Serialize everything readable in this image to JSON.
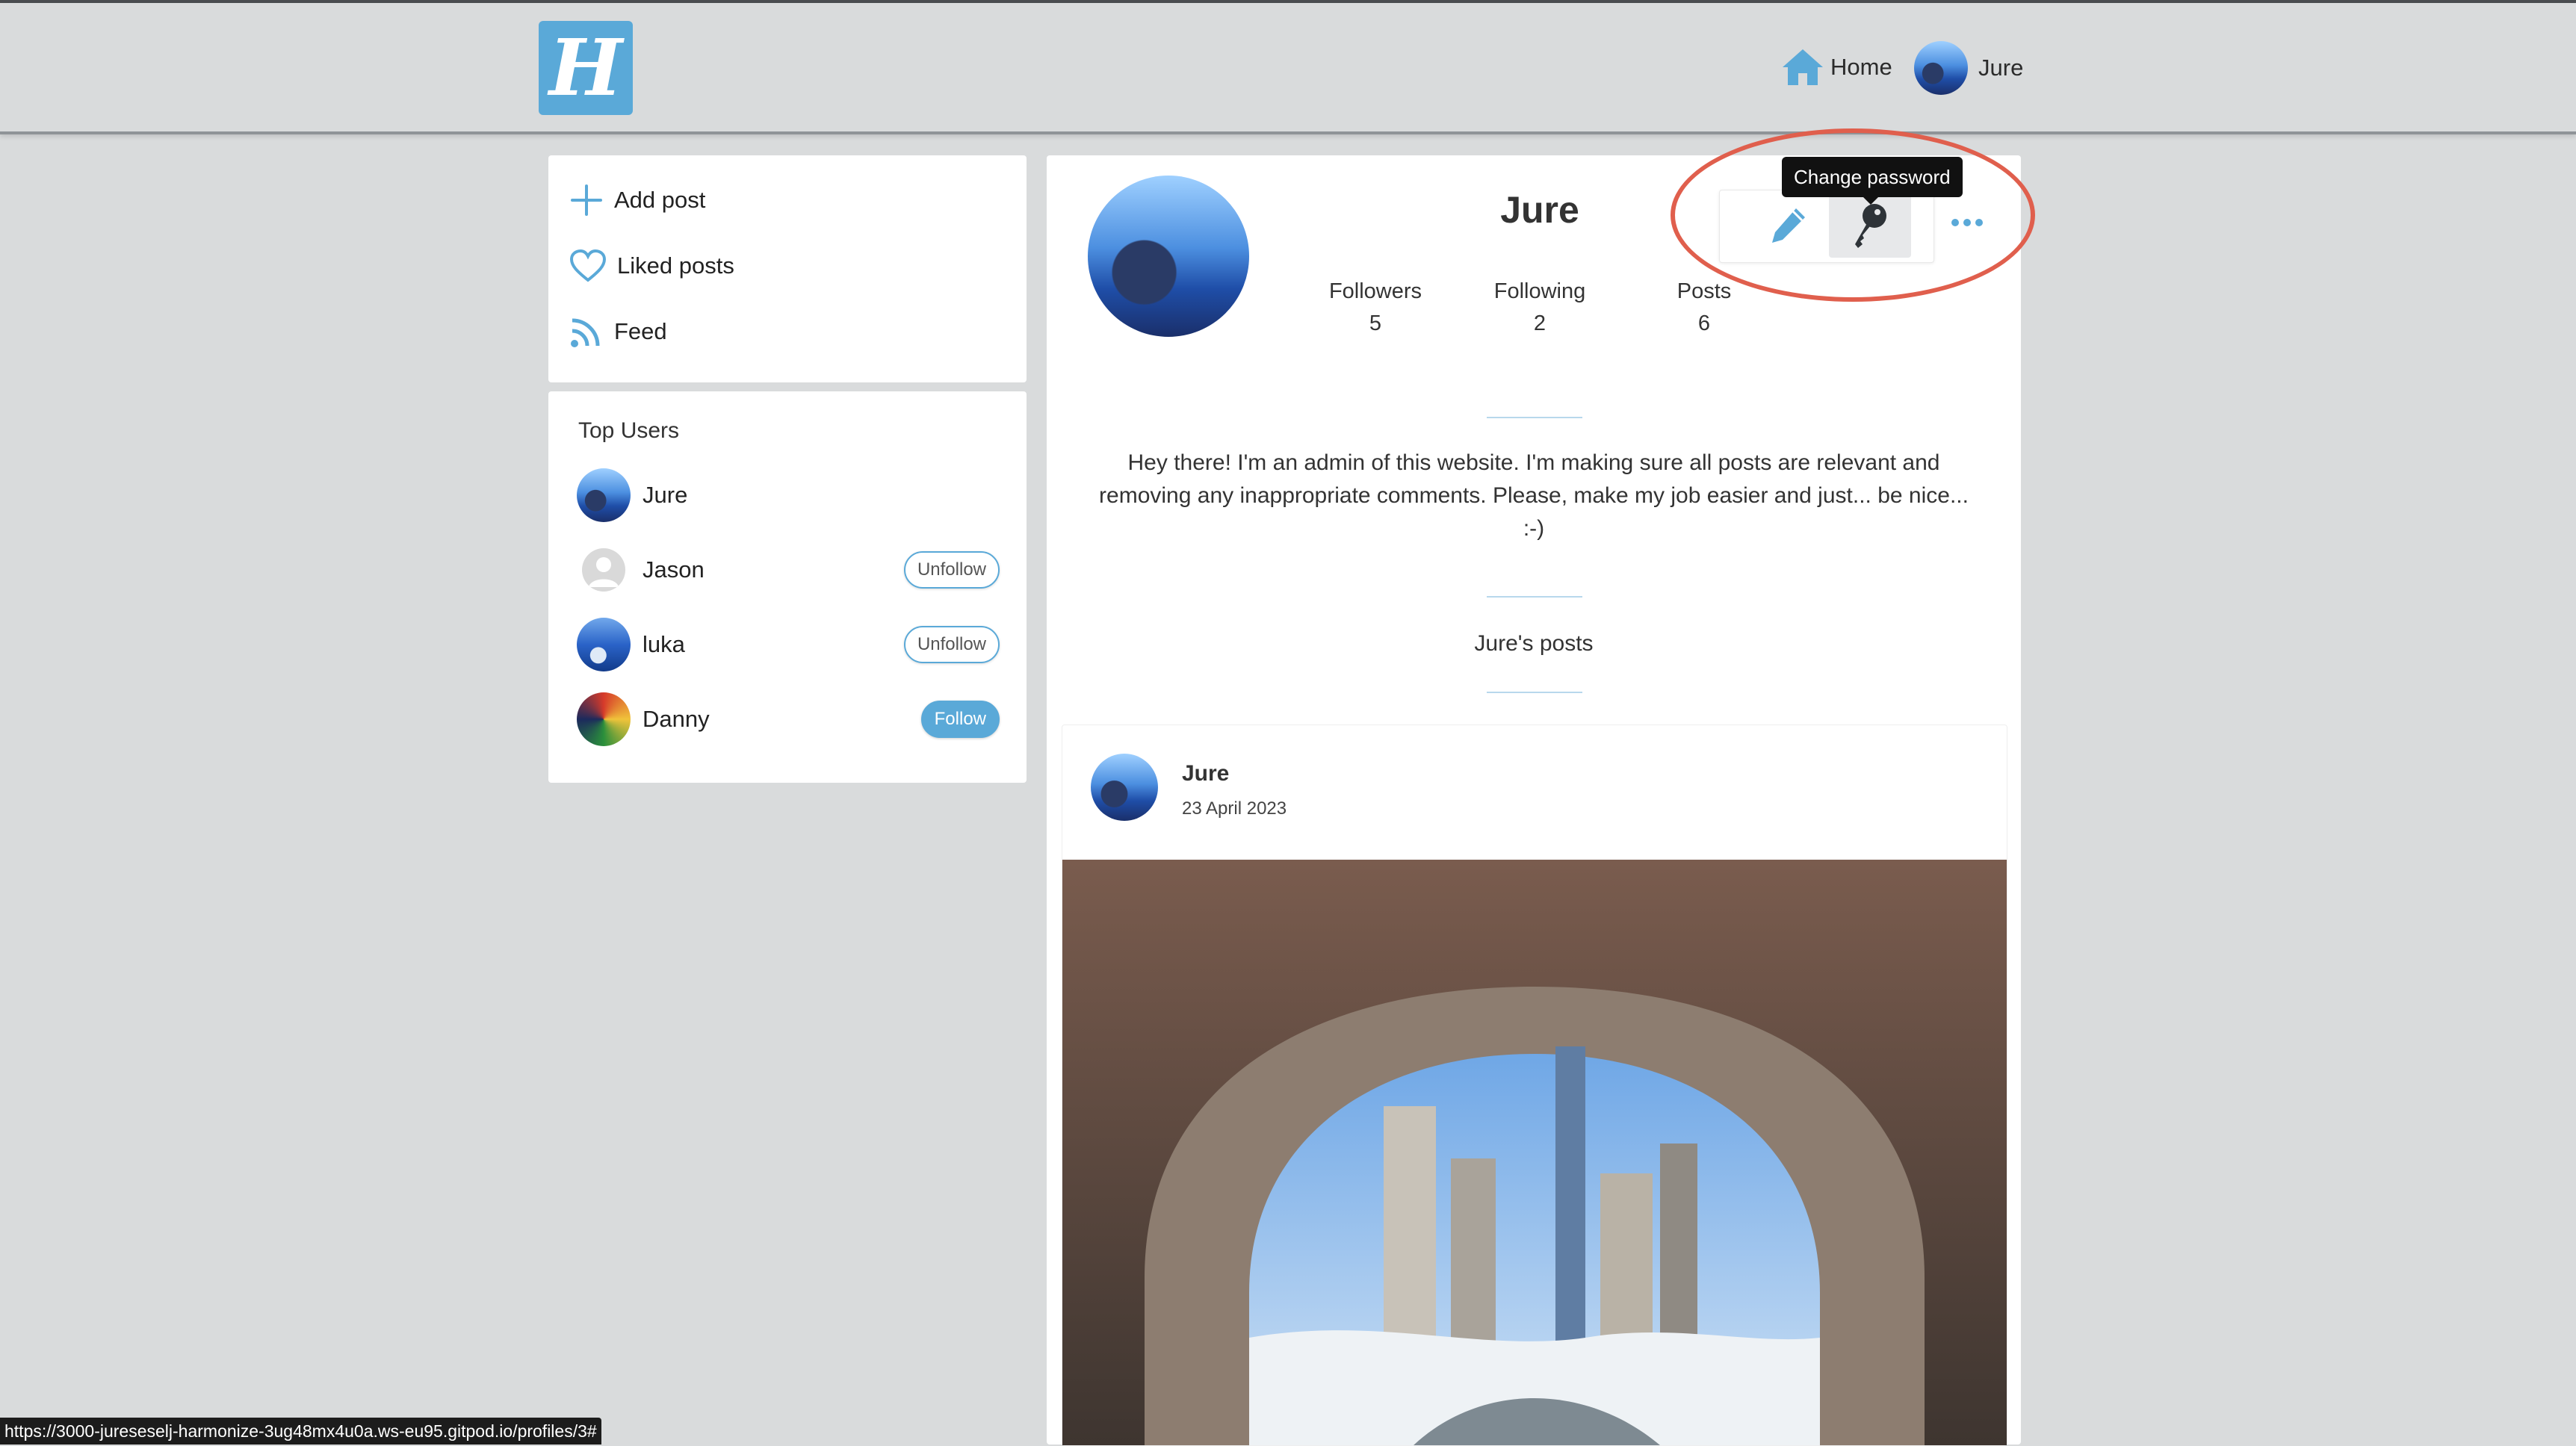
{
  "nav": {
    "logo_letter": "H",
    "home_label": "Home",
    "user_label": "Jure"
  },
  "sidebar": {
    "menu": [
      {
        "label": "Add post",
        "icon": "plus-icon"
      },
      {
        "label": "Liked posts",
        "icon": "heart-icon"
      },
      {
        "label": "Feed",
        "icon": "rss-icon"
      }
    ],
    "top_users_title": "Top Users",
    "top_users": [
      {
        "name": "Jure",
        "action": ""
      },
      {
        "name": "Jason",
        "action": "Unfollow"
      },
      {
        "name": "luka",
        "action": "Unfollow"
      },
      {
        "name": "Danny",
        "action": "Follow"
      }
    ]
  },
  "profile": {
    "name": "Jure",
    "stats": [
      {
        "label": "Followers",
        "value": "5"
      },
      {
        "label": "Following",
        "value": "2"
      },
      {
        "label": "Posts",
        "value": "6"
      }
    ],
    "tooltip": "Change password",
    "bio": "Hey there! I'm an admin of this website. I'm making sure all posts are relevant and removing any inappropriate comments. Please, make my job easier and just... be nice... :-)",
    "posts_heading": "Jure's posts"
  },
  "post": {
    "author": "Jure",
    "date": "23 April 2023"
  },
  "status_url": "https://3000-jureseselj-harmonize-3ug48mx4u0a.ws-eu95.gitpod.io/profiles/3#",
  "colors": {
    "accent": "#5aa9d8",
    "highlight_ring": "#e05f4d",
    "background": "#d9dbdc"
  }
}
